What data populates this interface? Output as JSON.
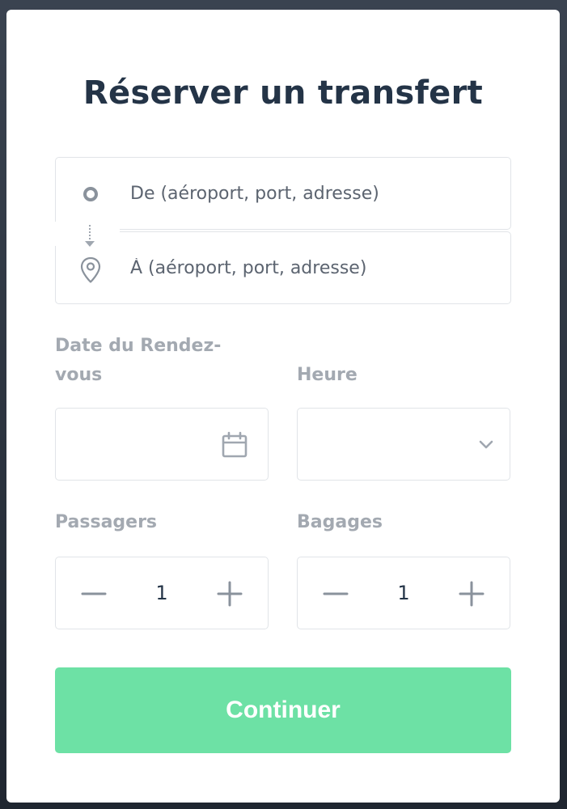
{
  "modal": {
    "title": "Réserver un transfert"
  },
  "route": {
    "from_placeholder": "De (aéroport, port, adresse)",
    "to_placeholder": "À (aéroport, port, adresse)",
    "from_value": "",
    "to_value": "",
    "from_icon": "circle-origin-icon",
    "connector_icon": "dotted-arrow-icon",
    "to_icon": "map-pin-icon"
  },
  "date": {
    "label": "Date du Rendez-vous",
    "value": "",
    "icon": "calendar-icon"
  },
  "time": {
    "label": "Heure",
    "value": "",
    "icon": "chevron-down-icon"
  },
  "passengers": {
    "label": "Passagers",
    "value": "1",
    "minus_icon": "minus-icon",
    "plus_icon": "plus-icon"
  },
  "luggage": {
    "label": "Bagages",
    "value": "1",
    "minus_icon": "minus-icon",
    "plus_icon": "plus-icon"
  },
  "cta": {
    "label": "Continuer"
  },
  "colors": {
    "title": "#243447",
    "label": "#a3a9b1",
    "border": "#e1e4e8",
    "accent": "#6de1a5",
    "icon": "#8a929c"
  }
}
